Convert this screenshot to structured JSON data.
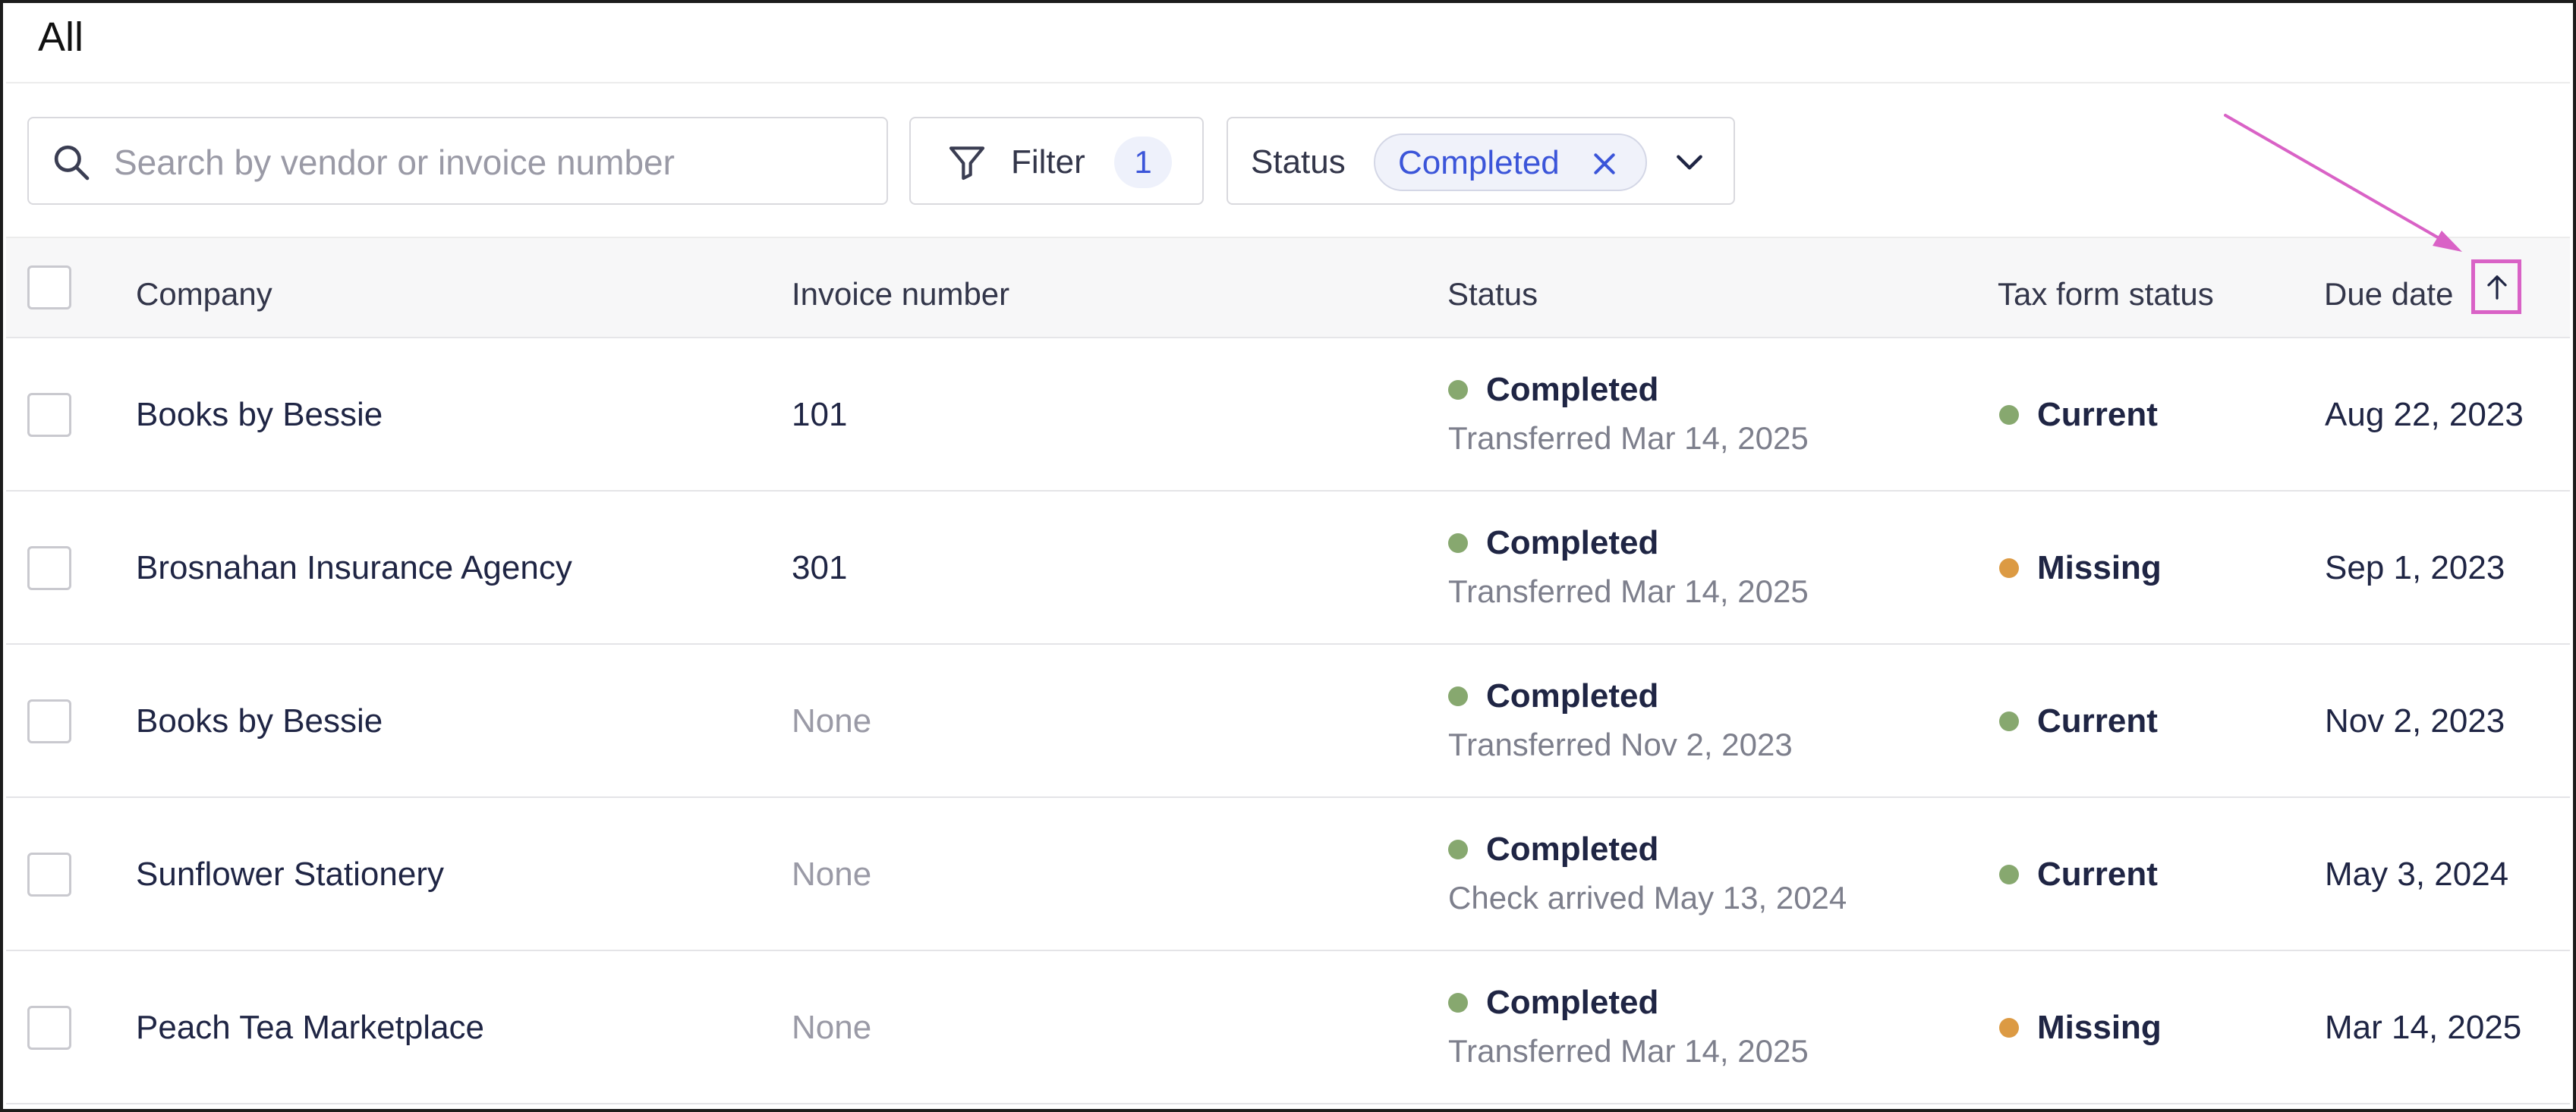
{
  "header": {
    "title": "All"
  },
  "toolbar": {
    "search_placeholder": "Search by vendor or invoice number",
    "search_value": "",
    "filter_label": "Filter",
    "filter_count": "1",
    "status_label": "Status",
    "status_chip": "Completed"
  },
  "table": {
    "columns": {
      "company": "Company",
      "invoice": "Invoice number",
      "status": "Status",
      "tax": "Tax form status",
      "due": "Due date"
    },
    "sort": {
      "column": "Due date",
      "direction": "ascending"
    },
    "rows": [
      {
        "company": "Books by Bessie",
        "invoice": "101",
        "invoice_muted": false,
        "status": "Completed",
        "status_detail": "Transferred Mar 14, 2025",
        "tax": "Current",
        "tax_color": "#87a86f",
        "due": "Aug 22, 2023"
      },
      {
        "company": "Brosnahan Insurance Agency",
        "invoice": "301",
        "invoice_muted": false,
        "status": "Completed",
        "status_detail": "Transferred Mar 14, 2025",
        "tax": "Missing",
        "tax_color": "#dc9a43",
        "due": "Sep 1, 2023"
      },
      {
        "company": "Books by Bessie",
        "invoice": "None",
        "invoice_muted": true,
        "status": "Completed",
        "status_detail": "Transferred Nov 2, 2023",
        "tax": "Current",
        "tax_color": "#87a86f",
        "due": "Nov 2, 2023"
      },
      {
        "company": "Sunflower Stationery",
        "invoice": "None",
        "invoice_muted": true,
        "status": "Completed",
        "status_detail": "Check arrived May 13, 2024",
        "tax": "Current",
        "tax_color": "#87a86f",
        "due": "May 3, 2024"
      },
      {
        "company": "Peach Tea Marketplace",
        "invoice": "None",
        "invoice_muted": true,
        "status": "Completed",
        "status_detail": "Transferred Mar 14, 2025",
        "tax": "Missing",
        "tax_color": "#dc9a43",
        "due": "Mar 14, 2025"
      }
    ]
  },
  "colors": {
    "status_completed": "#87a86f",
    "accent": "#3b55d9",
    "annotation": "#d962c6"
  }
}
